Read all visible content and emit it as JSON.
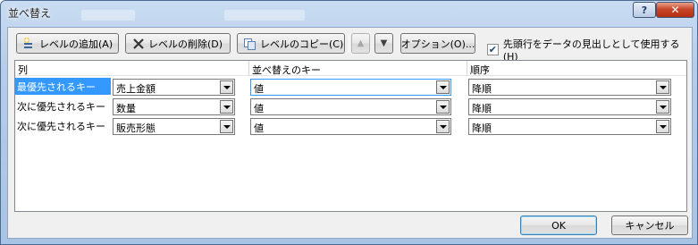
{
  "window": {
    "title": "並べ替え",
    "help_label": "?",
    "close_label": "✕"
  },
  "toolbar": {
    "add_level": "レベルの追加(A)",
    "delete_level": "レベルの削除(D)",
    "copy_level": "レベルのコピー(C)",
    "move_up_icon": "▲",
    "move_down_icon": "▼",
    "options": "オプション(O)...",
    "header_checkbox_label": "先頭行をデータの見出しとして使用する(H)",
    "header_checkbox_checked": true,
    "check_mark": "✔"
  },
  "grid": {
    "headers": {
      "column": "列",
      "sort_on": "並べ替えのキー",
      "order": "順序"
    },
    "rows": [
      {
        "label": "最優先されるキー",
        "column": "売上金額",
        "sort_on": "値",
        "order": "降順",
        "selected": true
      },
      {
        "label": "次に優先されるキー",
        "column": "数量",
        "sort_on": "値",
        "order": "降順",
        "selected": false
      },
      {
        "label": "次に優先されるキー",
        "column": "販売形態",
        "sort_on": "値",
        "order": "降順",
        "selected": false
      }
    ]
  },
  "footer": {
    "ok": "OK",
    "cancel": "キャンセル"
  },
  "colors": {
    "accent": "#3399ff",
    "close_red": "#c8482c",
    "frame": "#b4cce9"
  }
}
